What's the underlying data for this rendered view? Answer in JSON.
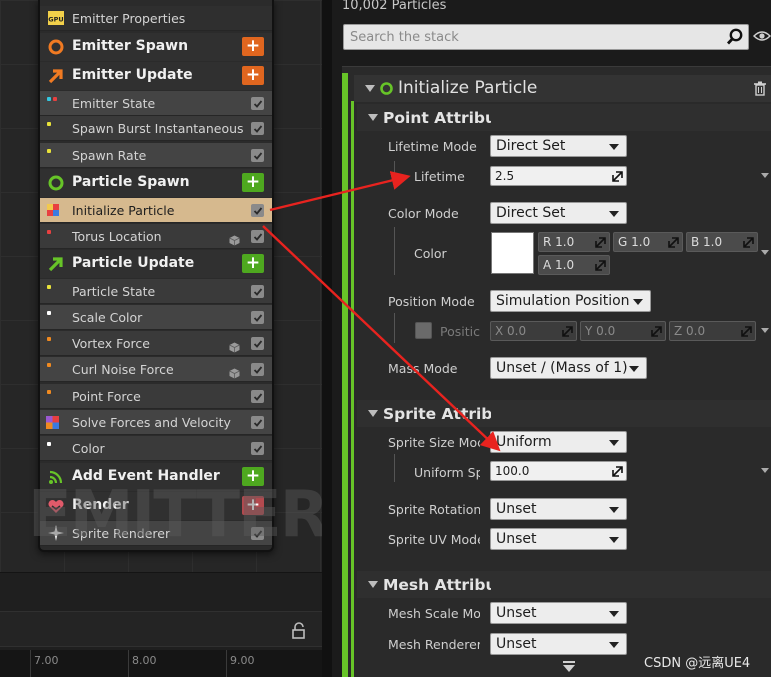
{
  "emitter": {
    "watermark": "EMITTER",
    "rows": [
      {
        "kind": "mod",
        "label": "Emitter Properties",
        "icon": "gpu-icon",
        "check": false
      },
      {
        "kind": "stage",
        "label": "Emitter Spawn",
        "icon": "emitter-spawn-icon",
        "plus": "orange"
      },
      {
        "kind": "stage",
        "label": "Emitter Update",
        "icon": "emitter-update-icon",
        "plus": "orange"
      },
      {
        "kind": "mod",
        "label": "Emitter State",
        "dot": "#33c7e0",
        "check": true
      },
      {
        "kind": "mod",
        "label": "Spawn Burst Instantaneous",
        "dot": "#e8e23a",
        "check": true
      },
      {
        "kind": "mod",
        "label": "Spawn Rate",
        "dot": "#e8e23a",
        "check": true
      },
      {
        "kind": "stage",
        "label": "Particle Spawn",
        "icon": "particle-spawn-icon",
        "plus": "green"
      },
      {
        "kind": "mod",
        "label": "Initialize Particle",
        "dot": "#e84040",
        "check": true,
        "selected": true
      },
      {
        "kind": "mod",
        "label": "Torus Location",
        "dot": "#e84040",
        "check": true,
        "cube": true
      },
      {
        "kind": "stage",
        "label": "Particle Update",
        "icon": "particle-update-icon",
        "plus": "green"
      },
      {
        "kind": "mod",
        "label": "Particle State",
        "dot": "#e8e23a",
        "check": true
      },
      {
        "kind": "mod",
        "label": "Scale Color",
        "dot": "#ffffff",
        "check": true
      },
      {
        "kind": "mod",
        "label": "Vortex Force",
        "dot": "#f08a20",
        "check": true,
        "cube": true
      },
      {
        "kind": "mod",
        "label": "Curl Noise Force",
        "dot": "#f08a20",
        "check": true,
        "cube": true
      },
      {
        "kind": "mod",
        "label": "Point Force",
        "dot": "#f08a20",
        "check": true
      },
      {
        "kind": "mod",
        "label": "Solve Forces and Velocity",
        "dot": "#e84040",
        "check": true
      },
      {
        "kind": "mod",
        "label": "Color",
        "dot": "#ffffff",
        "check": true
      },
      {
        "kind": "stage",
        "label": "Add Event Handler",
        "icon": "event-handler-icon",
        "plus": "green"
      },
      {
        "kind": "stage",
        "label": "Render",
        "icon": "render-icon",
        "plus": "red"
      },
      {
        "kind": "mod",
        "label": "Sprite Renderer",
        "icon": "sprite-icon",
        "check": true
      }
    ]
  },
  "timeline": {
    "ticks": [
      "7.00",
      "8.00",
      "9.00"
    ]
  },
  "stack": {
    "particle_count": "10,002 Particles",
    "search_placeholder": "Search the stack",
    "module_title": "Initialize Particle",
    "sections": {
      "point": "Point Attribut",
      "sprite": "Sprite Attribu",
      "mesh": "Mesh Attribut"
    },
    "props": {
      "lifetime_mode": {
        "label": "Lifetime Mode",
        "value": "Direct Set"
      },
      "lifetime": {
        "label": "Lifetime",
        "value": "2.5"
      },
      "color_mode": {
        "label": "Color Mode",
        "value": "Direct Set"
      },
      "color": {
        "label": "Color",
        "r": "R  1.0",
        "g": "G  1.0",
        "b": "B  1.0",
        "a": "A  1.0",
        "swatch": "#ffffff"
      },
      "position_mode": {
        "label": "Position Mode",
        "value": "Simulation Position"
      },
      "position": {
        "label": "Positic",
        "x": "X  0.0",
        "y": "Y  0.0",
        "z": "Z  0.0"
      },
      "mass_mode": {
        "label": "Mass Mode",
        "value": "Unset / (Mass of 1)"
      },
      "sprite_size_mode": {
        "label": "Sprite Size Moc",
        "value": "Uniform"
      },
      "uniform_sprite_size": {
        "label": "Uniform Sp",
        "value": "100.0"
      },
      "sprite_rotation_mode": {
        "label": "Sprite Rotation I",
        "value": "Unset"
      },
      "sprite_uv_mode": {
        "label": "Sprite UV Mode",
        "value": "Unset"
      },
      "mesh_scale_mode": {
        "label": "Mesh Scale Moc",
        "value": "Unset"
      },
      "mesh_renderer": {
        "label": "Mesh Renderer",
        "value": "Unset"
      }
    }
  },
  "credit": "CSDN @远离UE4",
  "colors": {
    "accent_green": "#67c428",
    "selection": "#d6b98e",
    "arrow": "#e8231f"
  }
}
